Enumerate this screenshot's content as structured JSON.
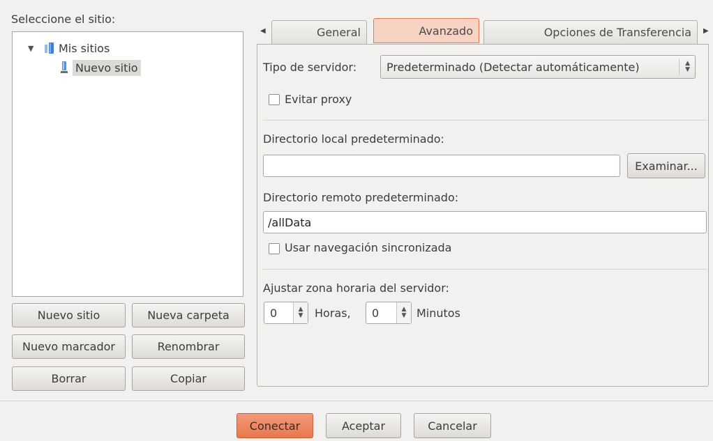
{
  "left": {
    "select_label": "Seleccione el sitio:",
    "tree": {
      "root_label": "Mis sitios",
      "child_label": "Nuevo sitio"
    },
    "buttons": {
      "new_site": "Nuevo sitio",
      "new_folder": "Nueva carpeta",
      "new_bookmark": "Nuevo marcador",
      "rename": "Renombrar",
      "delete": "Borrar",
      "copy": "Copiar"
    }
  },
  "tabs": {
    "general": "General",
    "advanced": "Avanzado",
    "transfer": "Opciones de Transferencia",
    "active": "Avanzado"
  },
  "advanced": {
    "server_type_label": "Tipo de servidor:",
    "server_type_value": "Predeterminado (Detectar automáticamente)",
    "bypass_proxy_label": "Evitar proxy",
    "bypass_proxy_checked": false,
    "local_dir_label": "Directorio local predeterminado:",
    "local_dir_value": "",
    "browse_label": "Examinar...",
    "remote_dir_label": "Directorio remoto predeterminado:",
    "remote_dir_value": "/allData",
    "sync_browsing_label": "Usar navegación sincronizada",
    "sync_browsing_checked": false,
    "timezone_label": "Ajustar zona horaria del servidor:",
    "hours_value": "0",
    "hours_label": "Horas,",
    "minutes_value": "0",
    "minutes_label": "Minutos"
  },
  "footer": {
    "connect": "Conectar",
    "ok": "Aceptar",
    "cancel": "Cancelar"
  },
  "colors": {
    "accent": "#e9784f",
    "active_tab_bg": "#f6d3c3",
    "window_bg": "#f2f1f0"
  }
}
